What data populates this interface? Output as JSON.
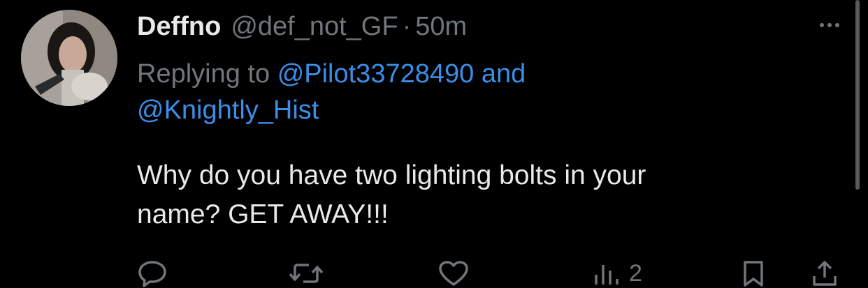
{
  "tweet": {
    "display_name": "Deffno",
    "handle": "@def_not_GF",
    "separator": "·",
    "timestamp": "50m",
    "replying_prefix": "Replying to",
    "replying_mention_1": "@Pilot33728490",
    "replying_conjunction": "and",
    "replying_mention_2": "@Knightly_Hist",
    "body_line_1": "Why do you have two lighting bolts in your",
    "body_line_2": "name? GET AWAY!!!"
  },
  "actions": {
    "reply_icon": "reply-icon",
    "retweet_icon": "retweet-icon",
    "like_icon": "heart-icon",
    "views_icon": "views-icon",
    "views_count": "2",
    "bookmark_icon": "bookmark-icon",
    "share_icon": "share-icon"
  },
  "colors": {
    "background": "#000000",
    "primary_text": "#e7e9ea",
    "secondary_text": "#71767b",
    "link": "#1d9bf0"
  }
}
